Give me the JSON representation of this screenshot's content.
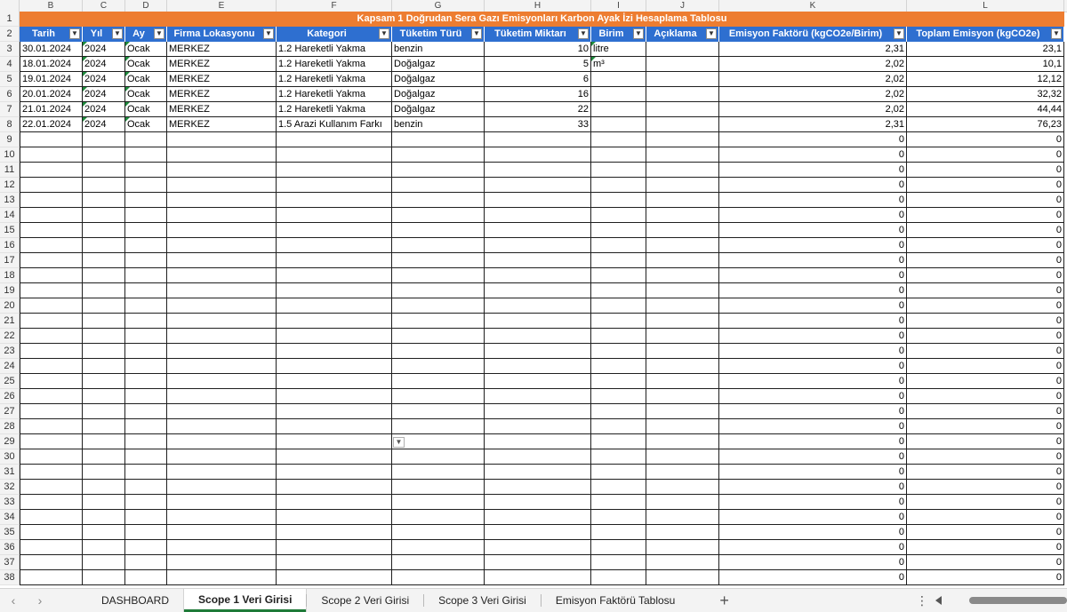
{
  "columns": [
    "B",
    "C",
    "D",
    "E",
    "F",
    "G",
    "H",
    "I",
    "J",
    "K",
    "L"
  ],
  "title": "Kapsam 1 Doğrudan Sera Gazı Emisyonları Karbon Ayak İzi Hesaplama Tablosu",
  "headers": [
    "Tarih",
    "Yıl",
    "Ay",
    "Firma Lokasyonu",
    "Kategori",
    "Tüketim Türü",
    "Tüketim Miktarı",
    "Birim",
    "Açıklama",
    "Emisyon Faktörü (kgCO2e/Birim)",
    "Toplam Emisyon (kgCO2e)"
  ],
  "row_numbers": [
    "1",
    "2",
    "3",
    "4",
    "5",
    "6",
    "7",
    "8",
    "9",
    "10",
    "11",
    "12",
    "13",
    "14",
    "15",
    "16",
    "17",
    "18",
    "19",
    "20",
    "21",
    "22",
    "23",
    "24",
    "25",
    "26",
    "27",
    "28",
    "29",
    "30",
    "31",
    "32",
    "33",
    "34",
    "35",
    "36",
    "37",
    "38"
  ],
  "data_rows": [
    [
      "30.01.2024",
      "2024",
      "Ocak",
      "MERKEZ",
      "1.2 Hareketli Yakma",
      "benzin",
      "10",
      "litre",
      "",
      "2,31",
      "23,1"
    ],
    [
      "18.01.2024",
      "2024",
      "Ocak",
      "MERKEZ",
      "1.2 Hareketli Yakma",
      "Doğalgaz",
      "5",
      "m³",
      "",
      "2,02",
      "10,1"
    ],
    [
      "19.01.2024",
      "2024",
      "Ocak",
      "MERKEZ",
      "1.2 Hareketli Yakma",
      "Doğalgaz",
      "6",
      "",
      "",
      "2,02",
      "12,12"
    ],
    [
      "20.01.2024",
      "2024",
      "Ocak",
      "MERKEZ",
      "1.2 Hareketli Yakma",
      "Doğalgaz",
      "16",
      "",
      "",
      "2,02",
      "32,32"
    ],
    [
      "21.01.2024",
      "2024",
      "Ocak",
      "MERKEZ",
      "1.2 Hareketli Yakma",
      "Doğalgaz",
      "22",
      "",
      "",
      "2,02",
      "44,44"
    ],
    [
      "22.01.2024",
      "2024",
      "Ocak",
      "MERKEZ",
      "1.5 Arazi Kullanım Farkı",
      "benzin",
      "33",
      "",
      "",
      "2,31",
      "76,23"
    ]
  ],
  "empty_value": "0",
  "empty_row_count": 30,
  "sheet_tabs": [
    "DASHBOARD",
    "Scope 1 Veri Girisi",
    "Scope 2 Veri Girisi",
    "Scope 3 Veri Girisi",
    "Emisyon Faktörü Tablosu"
  ],
  "active_tab": "Scope 1 Veri Girisi",
  "icons": {
    "nav_prev": "chevron-left-icon",
    "nav_next": "chevron-right-icon",
    "add_sheet": "plus-icon",
    "dropdown": "chevron-down-icon",
    "more": "more-vertical-icon"
  },
  "colors": {
    "title_bg": "#ed7d31",
    "header_bg": "#2e6fd0",
    "active_tab_accent": "#1e7a38"
  }
}
